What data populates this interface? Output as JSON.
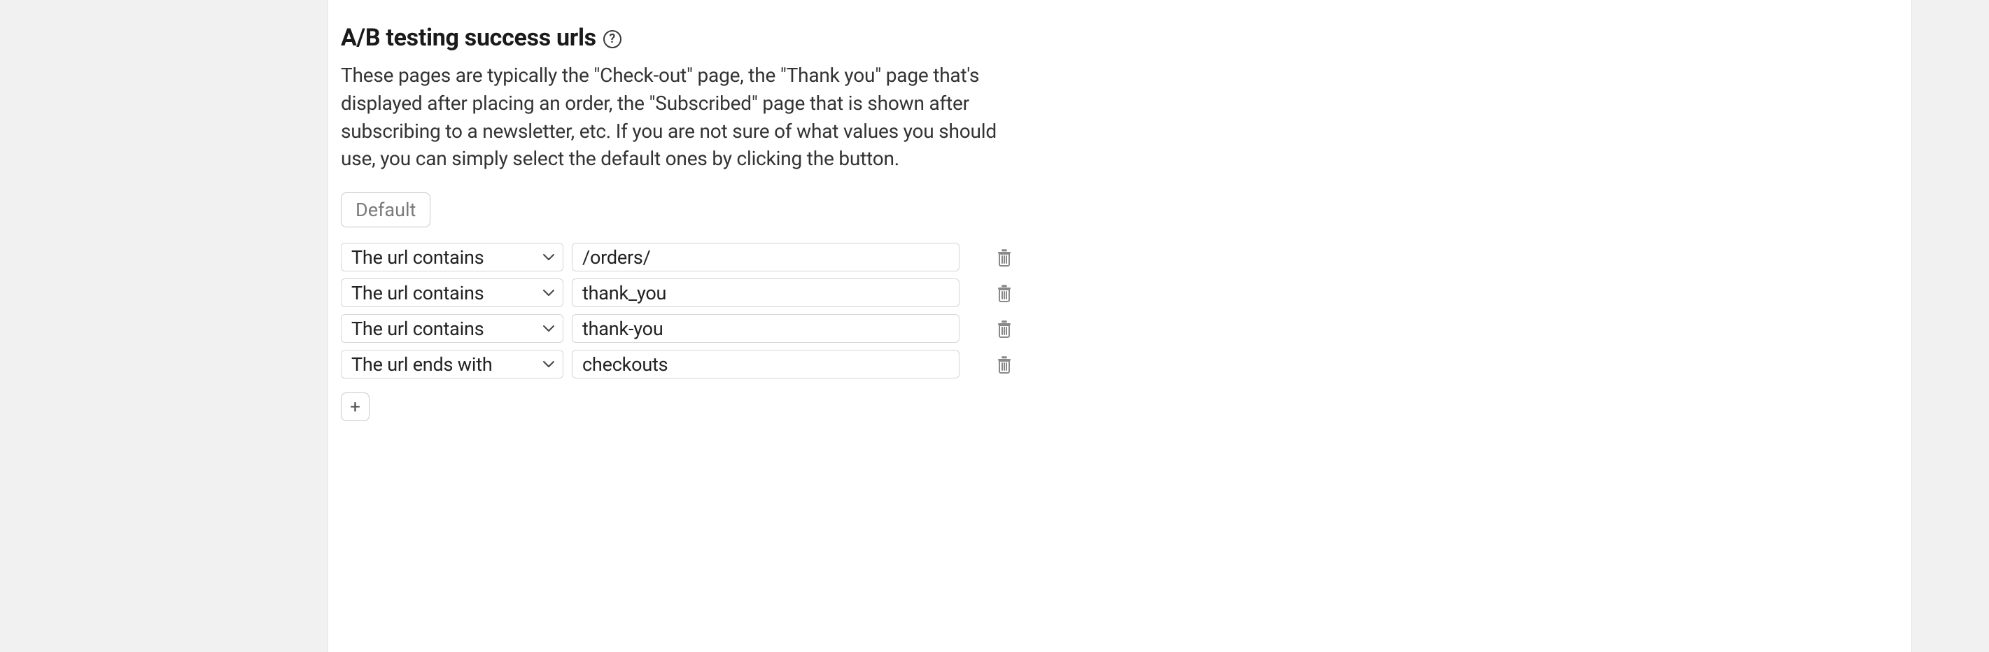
{
  "section": {
    "title": "A/B testing success urls",
    "help_icon": "?",
    "description": "These pages are typically the \"Check-out\" page, the \"Thank you\" page that's displayed after placing an order, the \"Subscribed\" page that is shown after subscribing to a newsletter, etc. If you are not sure of what values you should use, you can simply select the default ones by clicking the button.",
    "default_button": "Default",
    "add_button": "+"
  },
  "condition_options": [
    "The url contains",
    "The url ends with"
  ],
  "rules": [
    {
      "condition": "The url contains",
      "value": "/orders/"
    },
    {
      "condition": "The url contains",
      "value": "thank_you"
    },
    {
      "condition": "The url contains",
      "value": "thank-you"
    },
    {
      "condition": "The url ends with",
      "value": "checkouts"
    }
  ]
}
